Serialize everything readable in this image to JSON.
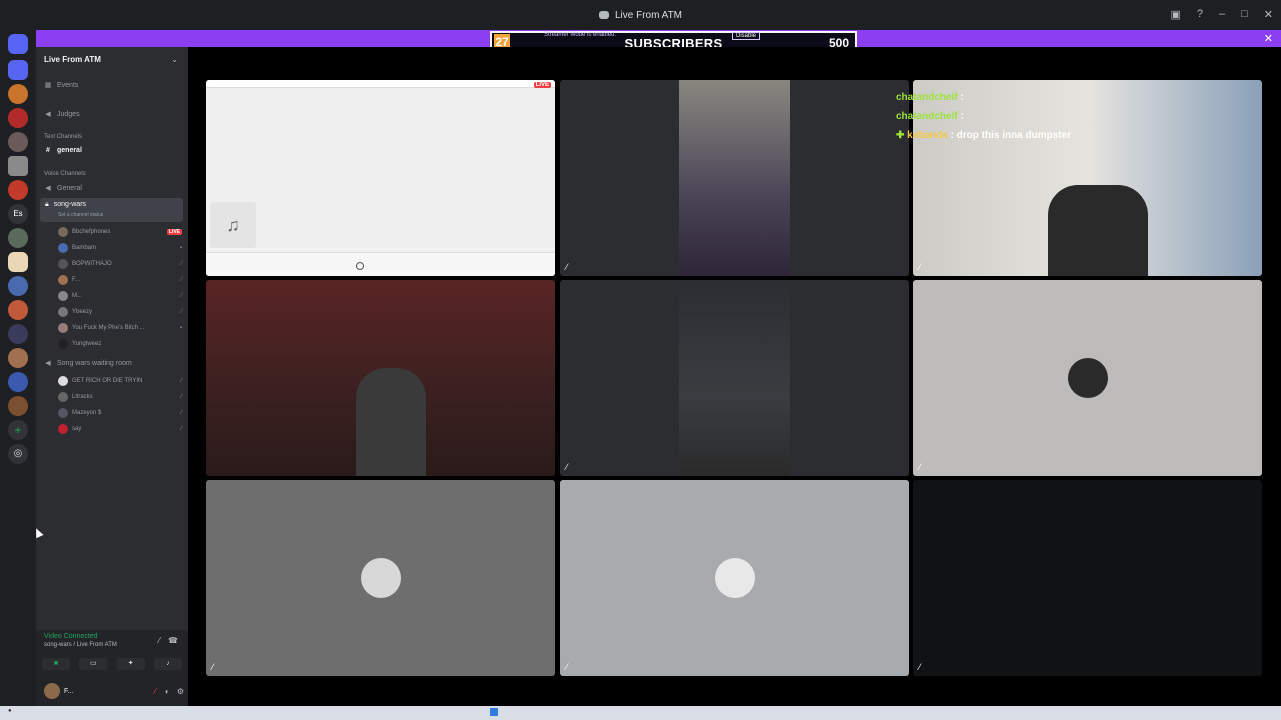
{
  "window": {
    "title": "Live From ATM"
  },
  "banner": {
    "streamer_mode_text": "Streamer Mode is enabled.",
    "disable_label": "Disable",
    "subs_count": "27",
    "subs_text": "SUBSCRIBERS",
    "subs_goal": "500",
    "close_glyph": "✕"
  },
  "sidebar": {
    "server_name": "Live From ATM",
    "events": "Events",
    "judges": "Judges",
    "text_category": "Text Channels",
    "general_text": "general",
    "voice_category": "Voice Channels",
    "general_voice": "General",
    "song_wars": "song-wars",
    "set_status": "Set a channel status",
    "waiting_room": "Song wars waiting room",
    "users": [
      {
        "name": "Bbchefphones",
        "live": "LIVE"
      },
      {
        "name": "Bambam"
      },
      {
        "name": "BOPWITHAJO"
      },
      {
        "name": "F..."
      },
      {
        "name": "M..."
      },
      {
        "name": "Ybeezy"
      },
      {
        "name": "You Fuck My Phe's Bitch ..."
      },
      {
        "name": "Yungtweez"
      }
    ],
    "waiting_users": [
      {
        "name": "GET RICH OR DIE TRYIN"
      },
      {
        "name": "Lltracks"
      },
      {
        "name": "Mazeyon $"
      },
      {
        "name": "say"
      }
    ]
  },
  "panel": {
    "connection_status": "Video Connected",
    "connection_location": "song-wars / Live From ATM",
    "username": "F..."
  },
  "chat": [
    {
      "name": "chatandcheif",
      "sep": " :",
      "msg": ""
    },
    {
      "name": "chatandcheif",
      "sep": " :",
      "msg": ""
    },
    {
      "name": "kebands",
      "sep": " :",
      "msg": " drop this inna dumpster"
    }
  ],
  "colors": {
    "banner": "#8c3ff0",
    "live": "#f23f43",
    "connected": "#23a55a",
    "chat_name_green": "#9ce33b",
    "chat_name_yellow": "#f6c945"
  }
}
